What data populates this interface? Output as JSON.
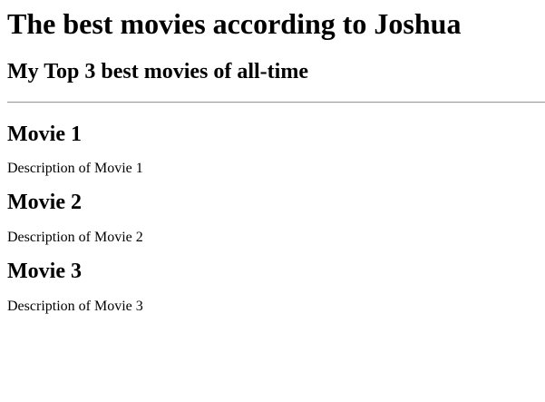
{
  "page": {
    "title": "The best movies according to Joshua",
    "subtitle": "My Top 3 best movies of all-time"
  },
  "movies": [
    {
      "title": "Movie 1",
      "description": "Description of Movie 1"
    },
    {
      "title": "Movie 2",
      "description": "Description of Movie 2"
    },
    {
      "title": "Movie 3",
      "description": "Description of Movie 3"
    }
  ]
}
